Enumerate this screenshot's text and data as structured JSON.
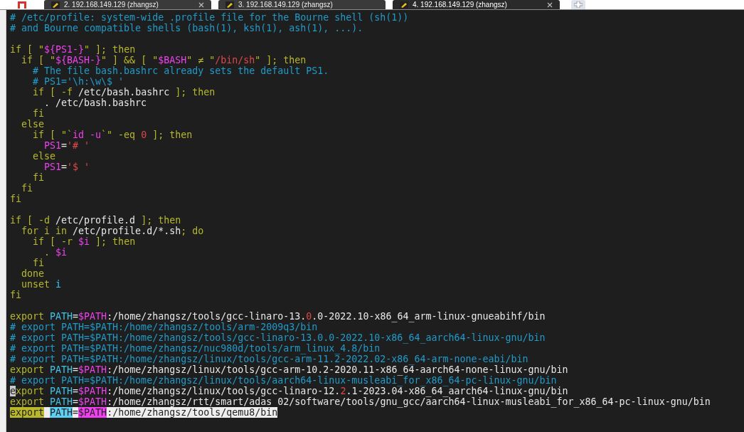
{
  "tabs": [
    {
      "label": "2. 192.168.149.129 (zhangsz)",
      "selected": false,
      "closable": true
    },
    {
      "label": "3. 192.168.149.129 (zhangsz)",
      "selected": false,
      "closable": false
    },
    {
      "label": "4. 192.168.149.129 (zhangsz)",
      "selected": true,
      "closable": true
    }
  ],
  "editor": {
    "lines": [
      {
        "segments": [
          {
            "kind": "comment",
            "text": "# /etc/profile: system-wide .profile file for the Bourne shell (sh(1))"
          }
        ]
      },
      {
        "segments": [
          {
            "kind": "comment",
            "text": "# and Bourne compatible shells (bash(1), ksh(1), ash(1), ...)."
          }
        ]
      },
      {
        "blank_before": true,
        "segments": [
          {
            "kind": "keyword",
            "text": "if [ \""
          },
          {
            "kind": "variable",
            "text": "${PS1-}"
          },
          {
            "kind": "keyword",
            "text": "\" ]; then"
          }
        ]
      },
      {
        "segments": [
          {
            "kind": "keyword",
            "text": "  if [ \""
          },
          {
            "kind": "variable",
            "text": "${BASH-}"
          },
          {
            "kind": "keyword",
            "text": "\" ] && [ \""
          },
          {
            "kind": "variable",
            "text": "$BASH"
          },
          {
            "kind": "keyword",
            "text": "\" ≠ \""
          },
          {
            "kind": "string",
            "text": "/bin/sh"
          },
          {
            "kind": "keyword",
            "text": "\" ]; then"
          }
        ]
      },
      {
        "segments": [
          {
            "kind": "comment",
            "text": "    # The file bash.bashrc already sets the default PS1."
          }
        ]
      },
      {
        "segments": [
          {
            "kind": "comment",
            "text": "    # PS1='\\h:\\w\\$ '"
          }
        ]
      },
      {
        "segments": [
          {
            "kind": "keyword",
            "text": "    if [ -f "
          },
          {
            "kind": "text",
            "text": "/etc/bash.bashrc"
          },
          {
            "kind": "keyword",
            "text": " ]; then"
          }
        ]
      },
      {
        "segments": [
          {
            "kind": "text",
            "text": "      . /etc/bash.bashrc"
          }
        ]
      },
      {
        "segments": [
          {
            "kind": "keyword",
            "text": "    fi"
          }
        ]
      },
      {
        "segments": [
          {
            "kind": "keyword",
            "text": "  else"
          }
        ]
      },
      {
        "segments": [
          {
            "kind": "keyword",
            "text": "    if [ \"`"
          },
          {
            "kind": "variable",
            "text": "id -u"
          },
          {
            "kind": "keyword",
            "text": "`\" -eq "
          },
          {
            "kind": "number",
            "text": "0"
          },
          {
            "kind": "keyword",
            "text": " ]; then"
          }
        ]
      },
      {
        "segments": [
          {
            "kind": "variable",
            "text": "      PS1"
          },
          {
            "kind": "text",
            "text": "="
          },
          {
            "kind": "string",
            "text": "'# '"
          }
        ]
      },
      {
        "segments": [
          {
            "kind": "keyword",
            "text": "    else"
          }
        ]
      },
      {
        "segments": [
          {
            "kind": "variable",
            "text": "      PS1"
          },
          {
            "kind": "text",
            "text": "="
          },
          {
            "kind": "string",
            "text": "'$ '"
          }
        ]
      },
      {
        "segments": [
          {
            "kind": "keyword",
            "text": "    fi"
          }
        ]
      },
      {
        "segments": [
          {
            "kind": "keyword",
            "text": "  fi"
          }
        ]
      },
      {
        "segments": [
          {
            "kind": "keyword",
            "text": "fi"
          }
        ]
      },
      {
        "blank_before": true,
        "segments": [
          {
            "kind": "keyword",
            "text": "if [ -d "
          },
          {
            "kind": "text",
            "text": "/etc/profile.d"
          },
          {
            "kind": "keyword",
            "text": " ]; then"
          }
        ]
      },
      {
        "segments": [
          {
            "kind": "keyword",
            "text": "  for i in "
          },
          {
            "kind": "text",
            "text": "/etc/profile.d/*.sh"
          },
          {
            "kind": "keyword",
            "text": "; do"
          }
        ]
      },
      {
        "segments": [
          {
            "kind": "keyword",
            "text": "    if [ -r "
          },
          {
            "kind": "variable",
            "text": "$i"
          },
          {
            "kind": "keyword",
            "text": " ]; then"
          }
        ]
      },
      {
        "segments": [
          {
            "kind": "keyword",
            "text": "      . "
          },
          {
            "kind": "variable",
            "text": "$i"
          }
        ]
      },
      {
        "segments": [
          {
            "kind": "keyword",
            "text": "    fi"
          }
        ]
      },
      {
        "segments": [
          {
            "kind": "keyword",
            "text": "  done"
          }
        ]
      },
      {
        "segments": [
          {
            "kind": "keyword",
            "text": "  unset "
          },
          {
            "kind": "ident",
            "text": "i"
          }
        ]
      },
      {
        "segments": [
          {
            "kind": "keyword",
            "text": "fi"
          }
        ]
      },
      {
        "blank_before": true,
        "segments": [
          {
            "kind": "keyword",
            "text": "export "
          },
          {
            "kind": "ident",
            "text": "PATH"
          },
          {
            "kind": "text",
            "text": "="
          },
          {
            "kind": "variable",
            "text": "$PATH"
          },
          {
            "kind": "text",
            "text": ":/home/zhangsz/tools/gcc-linaro-13."
          },
          {
            "kind": "number",
            "text": "0"
          },
          {
            "kind": "text",
            "text": ".0-2022.10-x86_64_arm-linux-gnueabihf/bin"
          }
        ]
      },
      {
        "segments": [
          {
            "kind": "comment",
            "text": "# export PATH=$PATH:/home/zhangsz/tools/arm-2009q3/bin"
          }
        ]
      },
      {
        "segments": [
          {
            "kind": "comment",
            "text": "# export PATH=$PATH:/home/zhangsz/tools/gcc-linaro-13.0.0-2022.10-x86_64_aarch64-linux-gnu/bin"
          }
        ]
      },
      {
        "segments": [
          {
            "kind": "comment",
            "text": "# export PATH=$PATH:/home/zhangsz/nuc980d/tools/arm_linux_4.8/bin"
          }
        ]
      },
      {
        "segments": [
          {
            "kind": "comment",
            "text": "# export PATH=$PATH:/home/zhangsz/linux/tools/gcc-arm-11.2-2022.02-x86_64-arm-none-eabi/bin"
          }
        ]
      },
      {
        "segments": [
          {
            "kind": "keyword",
            "text": "export "
          },
          {
            "kind": "ident",
            "text": "PATH"
          },
          {
            "kind": "text",
            "text": "="
          },
          {
            "kind": "variable",
            "text": "$PATH"
          },
          {
            "kind": "text",
            "text": ":/home/zhangsz/linux/tools/gcc-arm-10.2-2020.11-x86_64-aarch64-none-linux-gnu/bin"
          }
        ]
      },
      {
        "segments": [
          {
            "kind": "comment",
            "text": "# export PATH=$PATH:/home/zhangsz/linux/tools/aarch64-linux-musleabi_for_x86_64-pc-linux-gnu/bin"
          }
        ]
      },
      {
        "segments": [
          {
            "kind": "cursor",
            "text": "e"
          },
          {
            "kind": "keyword",
            "text": "xport "
          },
          {
            "kind": "ident",
            "text": "PATH"
          },
          {
            "kind": "text",
            "text": "="
          },
          {
            "kind": "variable",
            "text": "$PATH"
          },
          {
            "kind": "text",
            "text": ":/home/zhangsz/linux/tools/gcc-linaro-12."
          },
          {
            "kind": "number",
            "text": "2"
          },
          {
            "kind": "text",
            "text": ".1-2023.04-x86_64_aarch64-linux-gnu/bin"
          }
        ]
      },
      {
        "segments": [
          {
            "kind": "keyword",
            "text": "export "
          },
          {
            "kind": "ident",
            "text": "PATH"
          },
          {
            "kind": "text",
            "text": "="
          },
          {
            "kind": "variable",
            "text": "$PATH"
          },
          {
            "kind": "text",
            "text": ":/home/zhangsz/rtt/smart/adas_02/software/tools/gnu_gcc/aarch64-linux-musleabi_for_x86_64-pc-linux-gnu/bin"
          }
        ]
      },
      {
        "highlighted": true,
        "segments": [
          {
            "kind": "keyword",
            "text": "export"
          },
          {
            "kind": "gap"
          },
          {
            "kind": "ident",
            "text": "PATH"
          },
          {
            "kind": "text",
            "text": "="
          },
          {
            "kind": "variable",
            "text": "$PATH"
          },
          {
            "kind": "text",
            "text": ":/home/zhangsz/tools/qemu8/bin"
          }
        ]
      }
    ]
  }
}
